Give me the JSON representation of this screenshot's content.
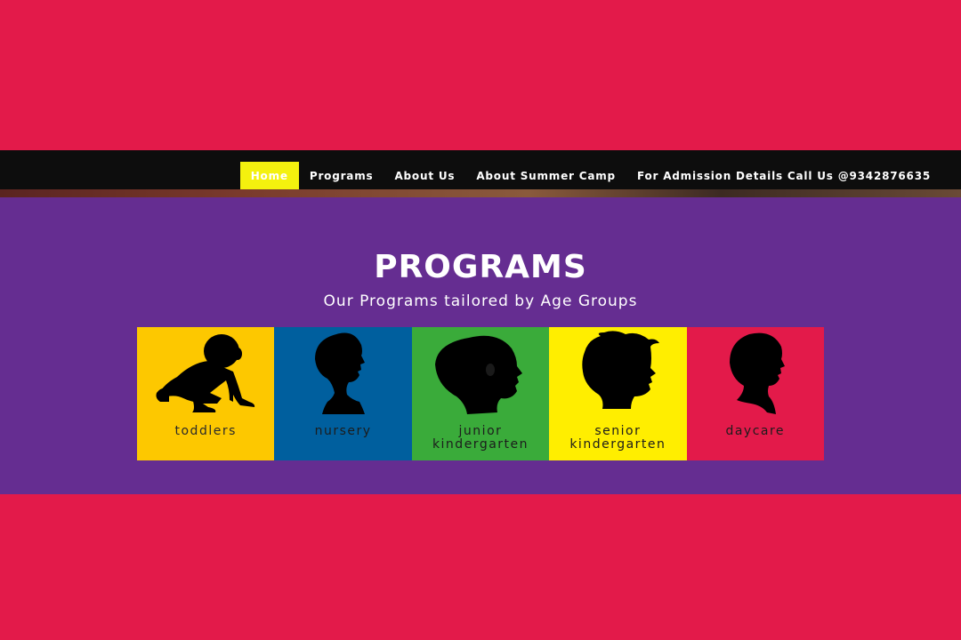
{
  "nav": {
    "items": [
      {
        "label": "Home",
        "active": true
      },
      {
        "label": "Programs",
        "active": false
      },
      {
        "label": "About Us",
        "active": false
      },
      {
        "label": "About Summer Camp",
        "active": false
      },
      {
        "label": "For Admission Details Call Us @9342876635",
        "active": false
      }
    ],
    "active_color": "#f4f10e"
  },
  "programs": {
    "title": "PROGRAMS",
    "subtitle": "Our Programs tailored by Age Groups",
    "cards": [
      {
        "label": "toddlers",
        "icon": "crawling-baby-silhouette-icon",
        "bg": "#fdc800",
        "text_color": "#2a2a2a"
      },
      {
        "label": "nursery",
        "icon": "toddler-profile-silhouette-icon",
        "bg": "#005f9e",
        "text_color": "#1c1c1c"
      },
      {
        "label": "junior\nkindergarten",
        "icon": "child-profile-silhouette-icon",
        "bg": "#3aab3a",
        "text_color": "#1c1c1c"
      },
      {
        "label": "senior\nkindergarten",
        "icon": "boy-profile-silhouette-icon",
        "bg": "#ffee00",
        "text_color": "#1c1c1c"
      },
      {
        "label": "daycare",
        "icon": "kid-profile-silhouette-icon",
        "bg": "#e31a4a",
        "text_color": "#1c1c1c"
      }
    ]
  },
  "colors": {
    "page_background": "#e31a4a",
    "navbar": "#0d0d0d",
    "section_background": "#652d91"
  }
}
